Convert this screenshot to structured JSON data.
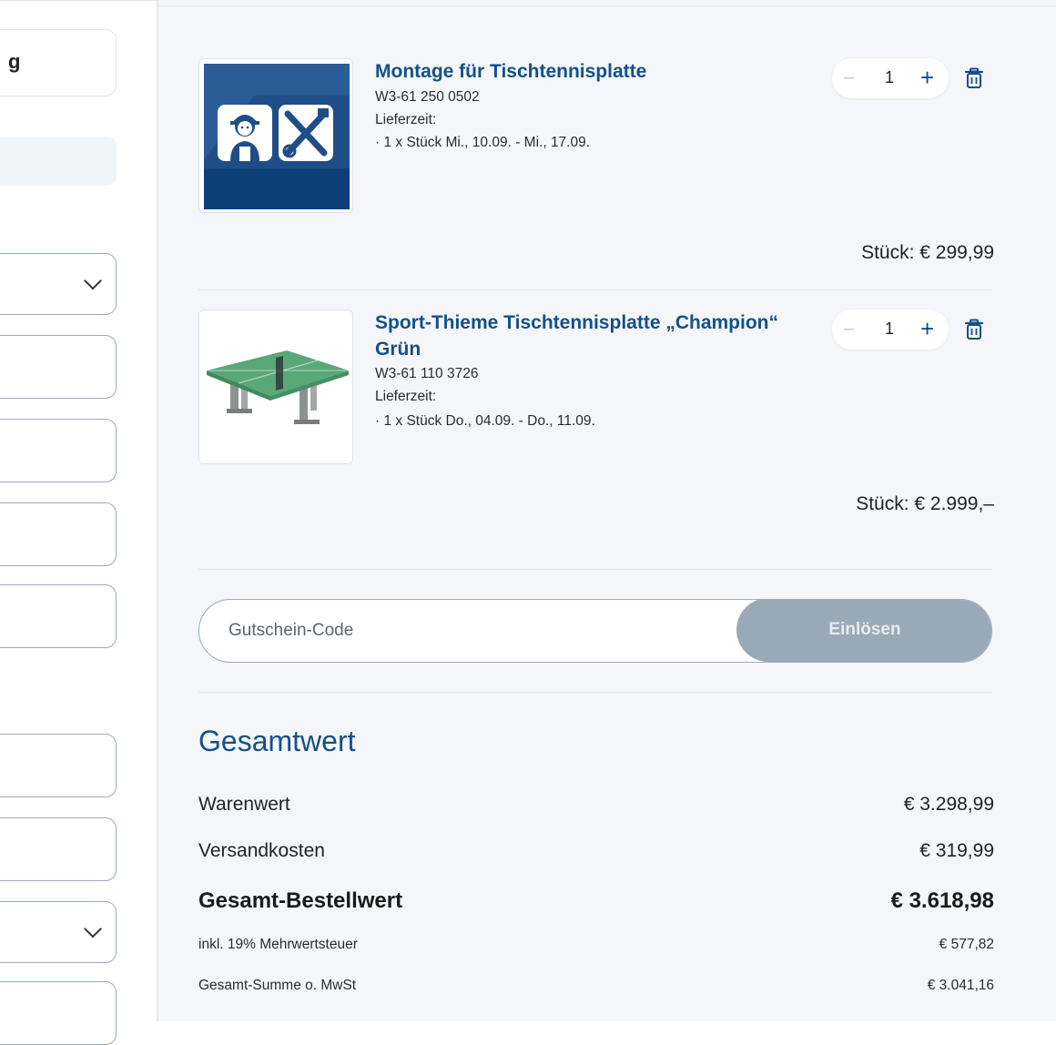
{
  "left_form": {
    "top_fragment": "g"
  },
  "cart": {
    "items": [
      {
        "title": "Montage für Tischtennisplatte",
        "sku": "W3-61 250 0502",
        "delivery_label": "Lieferzeit:",
        "delivery_detail": "· 1 x Stück Mi., 10.09. - Mi., 17.09.",
        "qty_minus": "−",
        "quantity": "1",
        "qty_plus": "+",
        "price": "Stück: € 299,99",
        "image_icon": "mechanic-tools-icon"
      },
      {
        "title": "Sport-Thieme Tischtennisplatte „Champion“ Grün",
        "sku": "W3-61 110 3726",
        "delivery_label": "Lieferzeit:",
        "delivery_detail": "· 1 x Stück Do., 04.09. - Do., 11.09.",
        "qty_minus": "−",
        "quantity": "1",
        "qty_plus": "+",
        "price": "Stück: € 2.999,–",
        "image_icon": "table-tennis-table-icon"
      }
    ]
  },
  "voucher": {
    "placeholder": "Gutschein-Code",
    "button_label": "Einlösen"
  },
  "totals": {
    "title": "Gesamtwert",
    "rows": [
      {
        "label": "Warenwert",
        "value": "€ 3.298,99"
      },
      {
        "label": "Versandkosten",
        "value": "€ 319,99"
      },
      {
        "label": "Gesamt-Bestellwert",
        "value": "€ 3.618,98"
      },
      {
        "label": "inkl. 19% Mehrwertsteuer",
        "value": "€ 577,82"
      },
      {
        "label": "Gesamt-Summe o. MwSt",
        "value": "€ 3.041,16"
      }
    ]
  },
  "colors": {
    "accent": "#13508a",
    "button_disabled": "#9aa9b6",
    "panel_bg": "#f4f6f9",
    "field_border": "#9aabbf"
  }
}
